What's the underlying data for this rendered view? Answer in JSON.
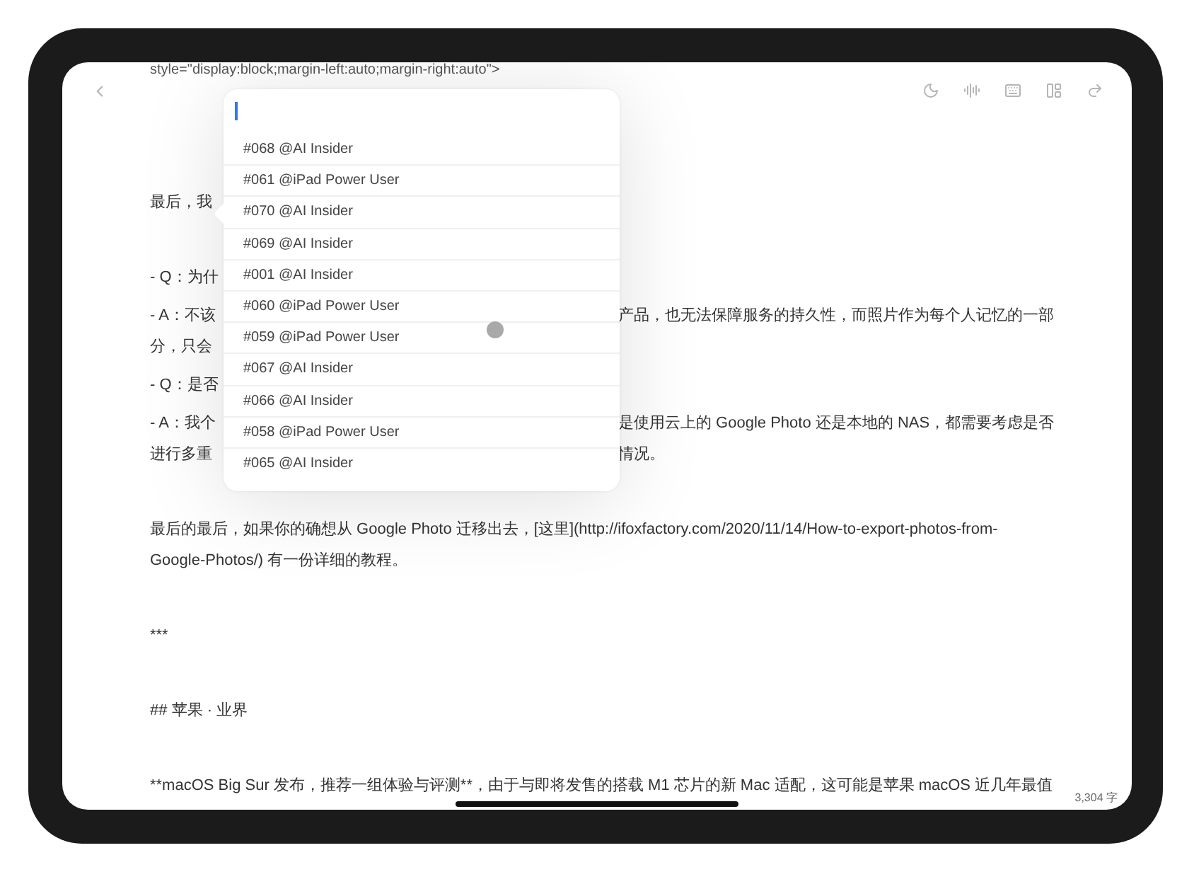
{
  "top_fragment": "style=\"display:block;margin-left:auto;margin-right:auto\">",
  "toolbar": {
    "back": true,
    "tools": [
      {
        "kind": "moon"
      },
      {
        "kind": "waveform"
      },
      {
        "kind": "keyboard"
      },
      {
        "kind": "layout"
      },
      {
        "kind": "redo"
      }
    ]
  },
  "paragraphs": [
    {
      "kind": "after_blank",
      "lines": [
        {
          "left": "最后，我"
        }
      ]
    },
    {
      "kind": "after_blank",
      "lines": [
        {
          "left": "- Q：为什"
        }
      ]
    },
    {
      "kind": "tight",
      "lines": [
        {
          "left": "- A：不该",
          "right": "产品，也无法保障服务的持久性，而照片作为每个人记忆的一部"
        },
        {
          "left": "分，只会"
        }
      ]
    },
    {
      "kind": "tight",
      "lines": [
        {
          "left": "- Q：是否"
        }
      ]
    },
    {
      "kind": "tight",
      "lines": [
        {
          "left": "- A：我个",
          "right": "是使用云上的 Google Photo 还是本地的 NAS，都需要考虑是否"
        },
        {
          "left": "进行多重",
          "right": "情况。"
        }
      ]
    },
    {
      "kind": "after_blank",
      "lines": [
        {
          "left": "最后的最后，如果你的确想从 Google Photo 迁移出去，[这里](http://ifoxfactory.com/2020/11/14/How-to-export-photos-from-"
        },
        {
          "left": "Google-Photos/) 有一份详细的教程。"
        }
      ]
    },
    {
      "kind": "after_blank",
      "lines": [
        {
          "left": "***"
        }
      ]
    },
    {
      "kind": "after_blank",
      "lines": [
        {
          "left": "## 苹果 · 业界"
        }
      ]
    },
    {
      "kind": "after_blank",
      "lines": [
        {
          "left": "**macOS Big Sur 发布，推荐一组体验与评测**，由于与即将发售的搭载 M1 芯片的新 Mac 适配，这可能是苹果 macOS 近几年最值"
        }
      ]
    }
  ],
  "popover": {
    "items": [
      "#068 @AI Insider",
      "#061 @iPad Power User",
      "#070 @AI Insider",
      "#069 @AI Insider",
      "#001 @AI Insider",
      "#060 @iPad Power User",
      "#059 @iPad Power User",
      "#067 @AI Insider",
      "#066 @AI Insider",
      "#058 @iPad Power User",
      "#065 @AI Insider"
    ]
  },
  "word_count": "3,304 字"
}
